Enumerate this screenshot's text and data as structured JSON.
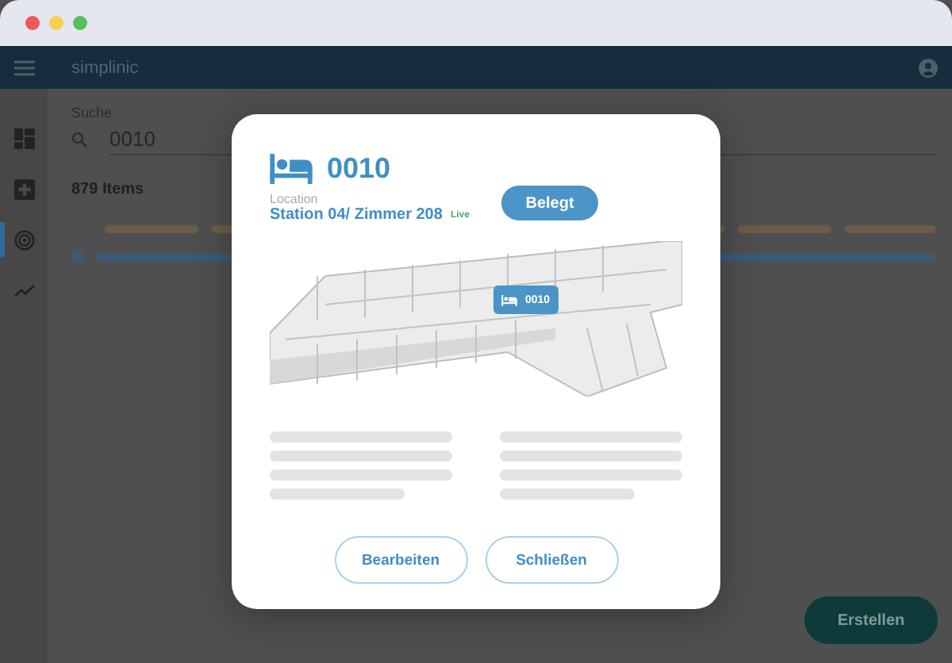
{
  "app_bar": {
    "title": "simplinic"
  },
  "sidebar": {
    "items": [
      {
        "kind": "grid",
        "selected": false
      },
      {
        "kind": "plus",
        "selected": false
      },
      {
        "kind": "radar",
        "selected": true
      },
      {
        "kind": "trend",
        "selected": false
      }
    ]
  },
  "search": {
    "label": "Suche",
    "value": "0010"
  },
  "list": {
    "count": "879 Items"
  },
  "dialog": {
    "title": "0010",
    "location_label": "Location",
    "location": "Station 04/ Zimmer 208",
    "live_badge": "Live",
    "status_button": "Belegt",
    "map_marker": "0010",
    "buttons": [
      "Bearbeiten",
      "Schließen"
    ]
  },
  "create_button": "Erstellen"
}
